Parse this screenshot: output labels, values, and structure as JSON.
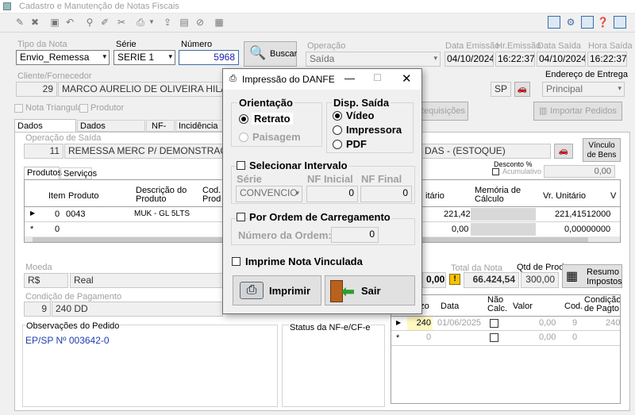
{
  "app": {
    "title": "Cadastro e Manutenção de Notas Fiscais"
  },
  "header": {
    "tipo_label": "Tipo da Nota",
    "tipo_value": "Envio_Remessa",
    "serie_label": "Série",
    "serie_value": "SERIE 1",
    "numero_label": "Número",
    "numero_value": "5968",
    "buscar_label": "Buscar",
    "operacao_label": "Operação",
    "operacao_value": "Saída",
    "data_emissao_label": "Data Emissão",
    "data_emissao_value": "04/10/2024",
    "hr_emissao_label": "Hr.Emissão",
    "hr_emissao_value": "16:22:37",
    "data_saida_label": "Data Saída",
    "data_saida_value": "04/10/2024",
    "hora_saida_label": "Hora Saída",
    "hora_saida_value": "16:22:37",
    "cliente_label": "Cliente/Fornecedor",
    "cliente_code": "29",
    "cliente_name": "MARCO AURELIO DE OLIVEIRA HILA",
    "uf": "SP",
    "endereco_label": "Endereço de Entrega",
    "endereco_value": "Principal",
    "nota_triangular": "Nota Triangular",
    "produtor": "Produtor",
    "requisicoes": "Requisições",
    "importar": "Importar Pedidos"
  },
  "tabs": [
    "Dados Principais",
    "Dados Secundários",
    "NF-e",
    "Incidência de"
  ],
  "operacao_saida": {
    "label": "Operação de Saída",
    "code": "11",
    "name": "REMESSA MERC P/ DEMONSTRAÇÃ",
    "suffix": "DAS -  (ESTOQUE)",
    "vinculo": "Vínculo de Bens"
  },
  "subtabs": [
    "Produtos",
    "Serviços"
  ],
  "desconto": {
    "label": "Desconto %",
    "acumulativo": "Acumulativo",
    "value": "0,00"
  },
  "items_table": {
    "headers": {
      "item": "Item",
      "produto": "Produto",
      "descricao": "Descrição do Produto",
      "cod": "Cod. Produto",
      "unit_pre": "Unitário",
      "memoria": "Memória de Cálculo",
      "vr_unitario": "Vr. Unitário",
      "v": "V"
    },
    "rows": [
      {
        "item": "0",
        "produto": "0043",
        "descricao": "MUK - GL 5LTS",
        "unit_pre": "221,42",
        "vr_unitario": "221,41512000"
      },
      {
        "item": "0",
        "produto": "",
        "descricao": "",
        "unit_pre": "0,00",
        "vr_unitario": "0,00000000"
      }
    ]
  },
  "moeda": {
    "label": "Moeda",
    "code": "R$",
    "name": "Real"
  },
  "condicao": {
    "label": "Condição de Pagamento",
    "code": "9",
    "name": "240 DD"
  },
  "totals": {
    "frete_value": "0,00",
    "total_label": "Total da Nota",
    "total_value": "66.424,54",
    "qtd_label": "Qtd de Prod.",
    "qtd_value": "300,00",
    "resumo": "Resumo Impostos"
  },
  "observacoes": {
    "label": "Observações do Pedido",
    "text": "EP/SP Nº 003642-0"
  },
  "status": {
    "label": "Status da NF-e/CF-e"
  },
  "parcelas": {
    "headers": {
      "prazo": "azo",
      "data": "Data",
      "nao_calc": "Não Calc.",
      "valor": "Valor",
      "cod": "Cod.",
      "condicao": "Condição de Pagto"
    },
    "rows": [
      {
        "prazo": "240",
        "data": "01/06/2025",
        "valor": "0,00",
        "cod": "9",
        "condicao": "240"
      },
      {
        "prazo": "0",
        "data": "",
        "valor": "0,00",
        "cod": "0",
        "condicao": ""
      }
    ]
  },
  "dialog": {
    "title": "Impressão do DANFE",
    "orientacao": "Orientação",
    "retrato": "Retrato",
    "paisagem": "Paisagem",
    "disp_saida": "Disp. Saída",
    "video": "Vídeo",
    "impressora": "Impressora",
    "pdf": "PDF",
    "selecionar_intervalo": "Selecionar Intervalo",
    "serie": "Série",
    "serie_value": "CONVENCIO",
    "nf_inicial": "NF Inicial",
    "nf_inicial_value": "0",
    "nf_final": "NF Final",
    "nf_final_value": "0",
    "ordem_carregamento": "Por Ordem de Carregamento",
    "numero_ordem": "Número da Ordem:",
    "numero_ordem_value": "0",
    "imprime_vinculada": "Imprime Nota Vinculada",
    "imprimir": "Imprimir",
    "sair": "Sair"
  }
}
